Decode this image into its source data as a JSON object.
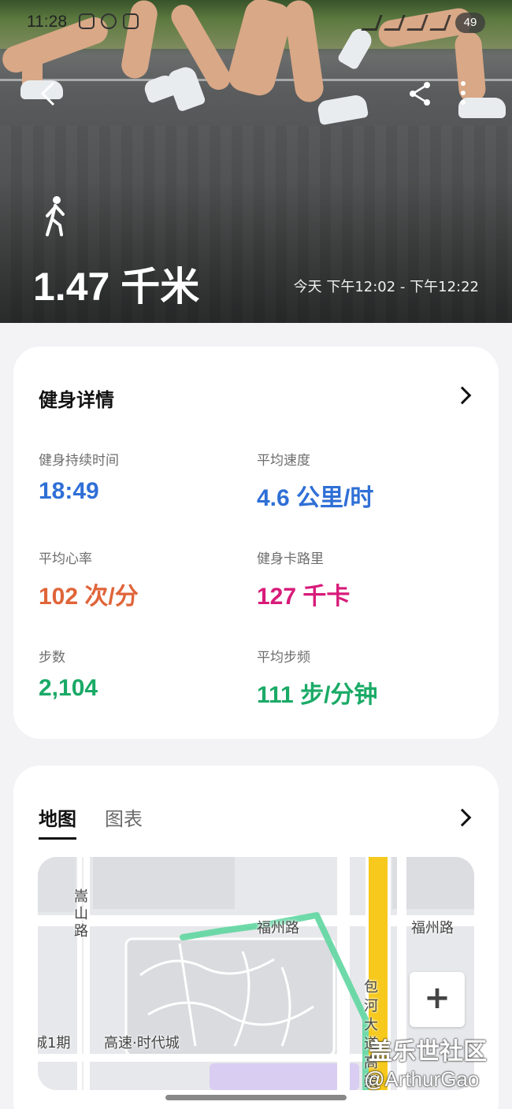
{
  "status_bar": {
    "time": "11:28",
    "battery": "49"
  },
  "hero": {
    "distance": "1.47 千米",
    "date_range": "今天 下午12:02 - 下午12:22",
    "back_icon": "chevron-left-icon",
    "share_icon": "share-icon",
    "more_icon": "more-vertical-icon",
    "activity_icon": "walking-person-icon"
  },
  "details": {
    "title": "健身详情",
    "metrics": [
      {
        "label": "健身持续时间",
        "value": "18:49",
        "color": "#2f6fd6"
      },
      {
        "label": "平均速度",
        "value": "4.6 公里/时",
        "color": "#2f6fd6"
      },
      {
        "label": "平均心率",
        "value": "102 次/分",
        "color": "#e0643a"
      },
      {
        "label": "健身卡路里",
        "value": "127 千卡",
        "color": "#d81b7a"
      },
      {
        "label": "步数",
        "value": "2,104",
        "color": "#1aaa66"
      },
      {
        "label": "平均步频",
        "value": "111 步/分钟",
        "color": "#1aaa66"
      }
    ]
  },
  "map_card": {
    "tabs": [
      "地图",
      "图表"
    ],
    "active_tab": "地图",
    "labels": {
      "songshan_road": "嵩山路",
      "fuzhou_road_1": "福州路",
      "fuzhou_road_2": "福州路",
      "baohe_expressway": "包河大道高架",
      "phase1": "城1期",
      "gaosu_times_city": "高速·时代城"
    },
    "zoom_in": "+"
  },
  "watermark": {
    "line1": "盖乐世社区",
    "line2": "@ArthurGao"
  }
}
